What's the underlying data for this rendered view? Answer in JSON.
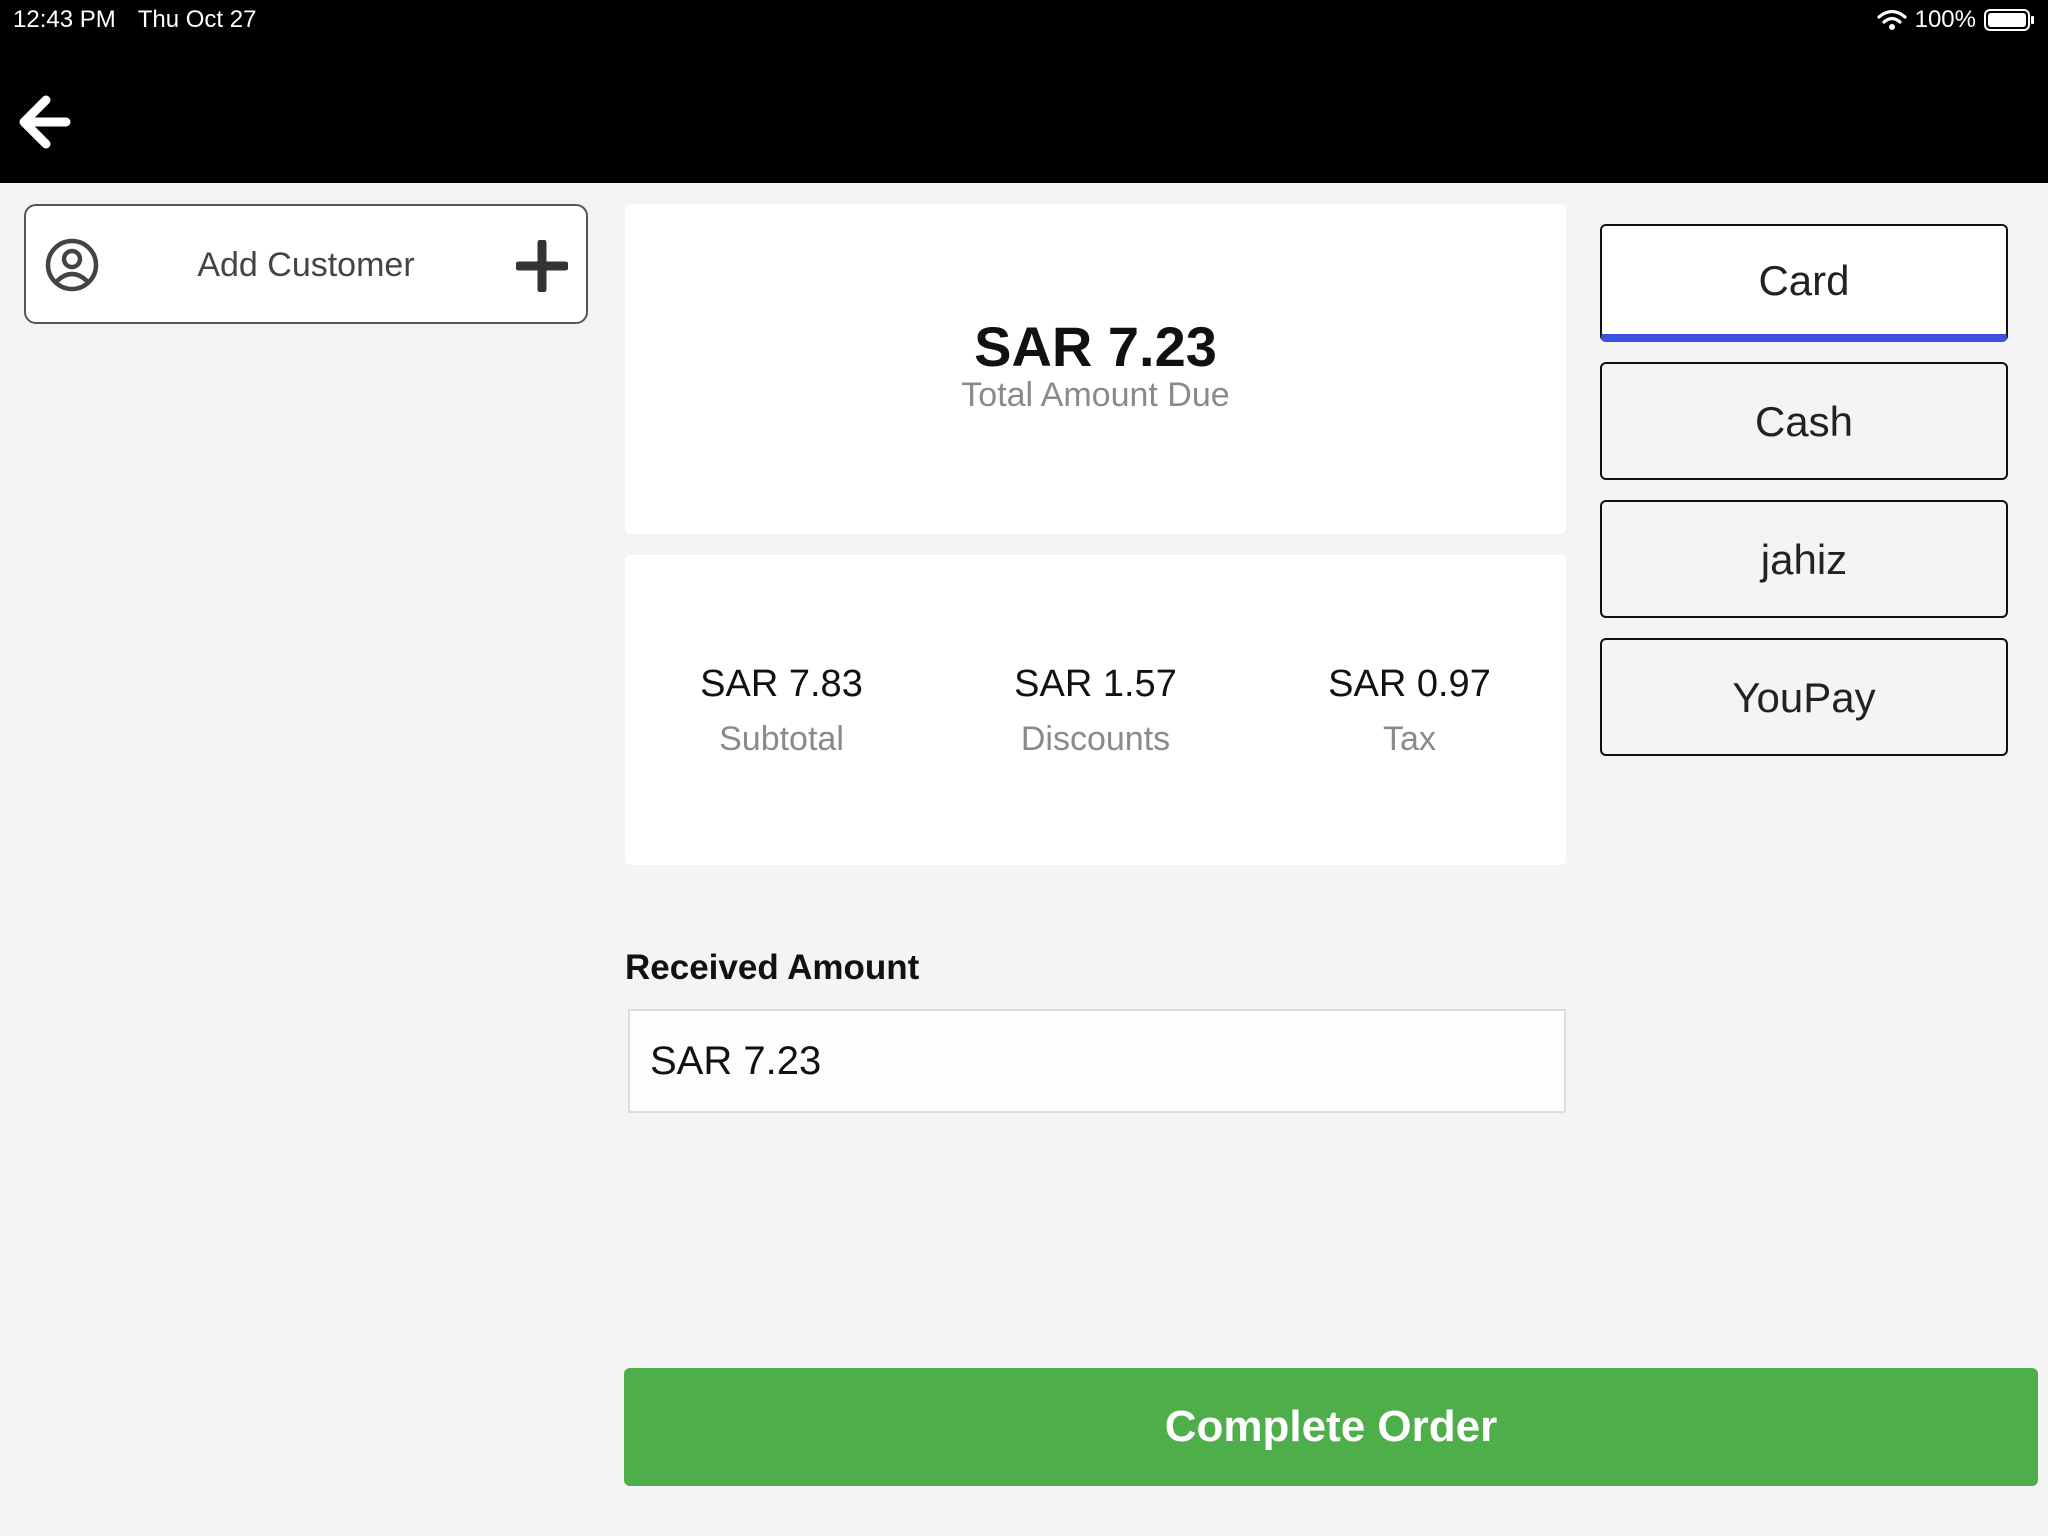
{
  "status_bar": {
    "time": "12:43 PM",
    "date": "Thu Oct 27",
    "battery": "100%"
  },
  "nav": {
    "back_icon": "arrow-left-icon"
  },
  "customer": {
    "label": "Add Customer",
    "icon": "user-circle-icon",
    "add_icon": "plus-icon"
  },
  "summary": {
    "total_amount": "SAR 7.23",
    "total_label": "Total Amount Due",
    "subtotal_value": "SAR 7.83",
    "subtotal_label": "Subtotal",
    "discounts_value": "SAR 1.57",
    "discounts_label": "Discounts",
    "tax_value": "SAR 0.97",
    "tax_label": "Tax"
  },
  "received": {
    "label": "Received Amount",
    "value": "SAR 7.23"
  },
  "payment_methods": [
    {
      "label": "Card",
      "selected": true
    },
    {
      "label": "Cash",
      "selected": false
    },
    {
      "label": "jahiz",
      "selected": false
    },
    {
      "label": "YouPay",
      "selected": false
    }
  ],
  "actions": {
    "complete_label": "Complete Order"
  },
  "colors": {
    "accent_blue": "#3d52e0",
    "complete_green": "#4eae4a"
  }
}
